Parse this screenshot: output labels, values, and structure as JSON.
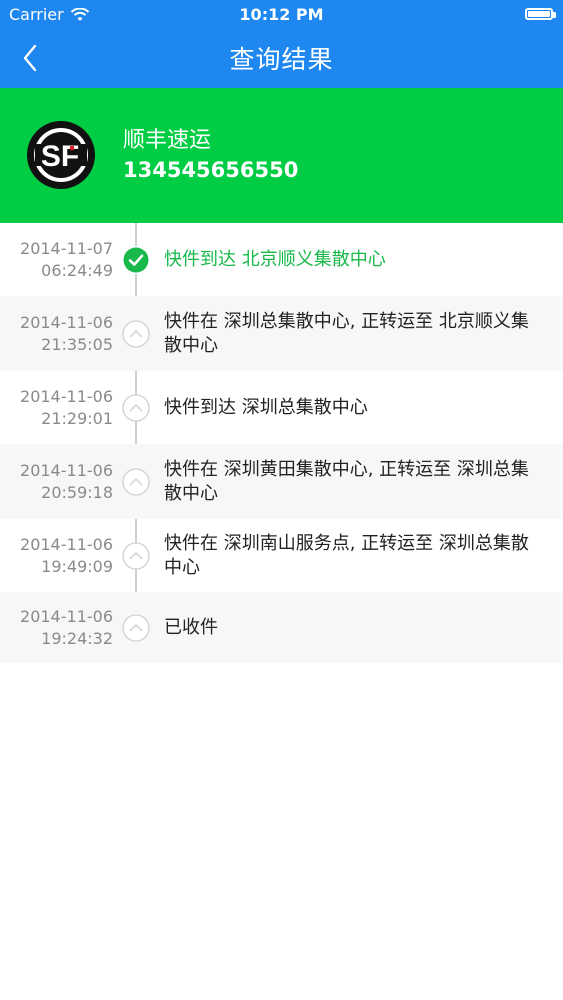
{
  "status_bar": {
    "carrier": "Carrier",
    "time": "10:12 PM",
    "battery_level": 1.0
  },
  "nav": {
    "title": "查询结果",
    "back_icon": "chevron-left-icon"
  },
  "company": {
    "name": "顺丰速运",
    "tracking_number": "13454565655​0",
    "logo_text": "SF"
  },
  "events": [
    {
      "date": "2014-11-07",
      "time": "06:24:49",
      "text": "快件到达 北京顺义集散中心",
      "status": "current"
    },
    {
      "date": "2014-11-06",
      "time": "21:35:05",
      "text": "快件在 深圳总集散中心, 正转运至 北京顺义集散中心",
      "status": "past"
    },
    {
      "date": "2014-11-06",
      "time": "21:29:01",
      "text": "快件到达 深圳总集散中心",
      "status": "past"
    },
    {
      "date": "2014-11-06",
      "time": "20:59:18",
      "text": "快件在 深圳黄田集散中心, 正转运至 深圳总集散中心",
      "status": "past"
    },
    {
      "date": "2014-11-06",
      "time": "19:49:09",
      "text": "快件在 深圳南山服务点, 正转运至 深圳总集散中心",
      "status": "past"
    },
    {
      "date": "2014-11-06",
      "time": "19:24:32",
      "text": "已收件",
      "status": "past"
    }
  ],
  "colors": {
    "nav_bg": "#1E87F0",
    "company_bg": "#00CC44",
    "current_event": "#18B84A",
    "timeline_line": "#CFCFCF"
  }
}
